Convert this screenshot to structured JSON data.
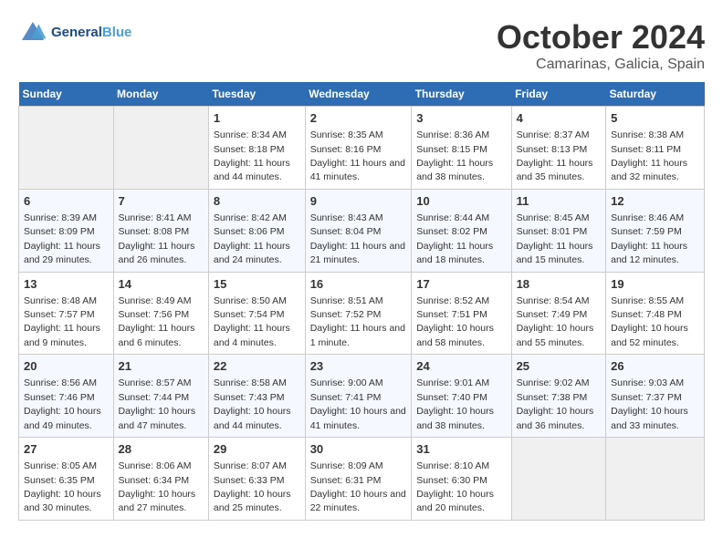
{
  "header": {
    "logo_text_general": "General",
    "logo_text_blue": "Blue",
    "month": "October 2024",
    "location": "Camarinas, Galicia, Spain"
  },
  "days_of_week": [
    "Sunday",
    "Monday",
    "Tuesday",
    "Wednesday",
    "Thursday",
    "Friday",
    "Saturday"
  ],
  "weeks": [
    [
      {
        "day": "",
        "empty": true
      },
      {
        "day": "",
        "empty": true
      },
      {
        "day": "1",
        "sunrise": "Sunrise: 8:34 AM",
        "sunset": "Sunset: 8:18 PM",
        "daylight": "Daylight: 11 hours and 44 minutes."
      },
      {
        "day": "2",
        "sunrise": "Sunrise: 8:35 AM",
        "sunset": "Sunset: 8:16 PM",
        "daylight": "Daylight: 11 hours and 41 minutes."
      },
      {
        "day": "3",
        "sunrise": "Sunrise: 8:36 AM",
        "sunset": "Sunset: 8:15 PM",
        "daylight": "Daylight: 11 hours and 38 minutes."
      },
      {
        "day": "4",
        "sunrise": "Sunrise: 8:37 AM",
        "sunset": "Sunset: 8:13 PM",
        "daylight": "Daylight: 11 hours and 35 minutes."
      },
      {
        "day": "5",
        "sunrise": "Sunrise: 8:38 AM",
        "sunset": "Sunset: 8:11 PM",
        "daylight": "Daylight: 11 hours and 32 minutes."
      }
    ],
    [
      {
        "day": "6",
        "sunrise": "Sunrise: 8:39 AM",
        "sunset": "Sunset: 8:09 PM",
        "daylight": "Daylight: 11 hours and 29 minutes."
      },
      {
        "day": "7",
        "sunrise": "Sunrise: 8:41 AM",
        "sunset": "Sunset: 8:08 PM",
        "daylight": "Daylight: 11 hours and 26 minutes."
      },
      {
        "day": "8",
        "sunrise": "Sunrise: 8:42 AM",
        "sunset": "Sunset: 8:06 PM",
        "daylight": "Daylight: 11 hours and 24 minutes."
      },
      {
        "day": "9",
        "sunrise": "Sunrise: 8:43 AM",
        "sunset": "Sunset: 8:04 PM",
        "daylight": "Daylight: 11 hours and 21 minutes."
      },
      {
        "day": "10",
        "sunrise": "Sunrise: 8:44 AM",
        "sunset": "Sunset: 8:02 PM",
        "daylight": "Daylight: 11 hours and 18 minutes."
      },
      {
        "day": "11",
        "sunrise": "Sunrise: 8:45 AM",
        "sunset": "Sunset: 8:01 PM",
        "daylight": "Daylight: 11 hours and 15 minutes."
      },
      {
        "day": "12",
        "sunrise": "Sunrise: 8:46 AM",
        "sunset": "Sunset: 7:59 PM",
        "daylight": "Daylight: 11 hours and 12 minutes."
      }
    ],
    [
      {
        "day": "13",
        "sunrise": "Sunrise: 8:48 AM",
        "sunset": "Sunset: 7:57 PM",
        "daylight": "Daylight: 11 hours and 9 minutes."
      },
      {
        "day": "14",
        "sunrise": "Sunrise: 8:49 AM",
        "sunset": "Sunset: 7:56 PM",
        "daylight": "Daylight: 11 hours and 6 minutes."
      },
      {
        "day": "15",
        "sunrise": "Sunrise: 8:50 AM",
        "sunset": "Sunset: 7:54 PM",
        "daylight": "Daylight: 11 hours and 4 minutes."
      },
      {
        "day": "16",
        "sunrise": "Sunrise: 8:51 AM",
        "sunset": "Sunset: 7:52 PM",
        "daylight": "Daylight: 11 hours and 1 minute."
      },
      {
        "day": "17",
        "sunrise": "Sunrise: 8:52 AM",
        "sunset": "Sunset: 7:51 PM",
        "daylight": "Daylight: 10 hours and 58 minutes."
      },
      {
        "day": "18",
        "sunrise": "Sunrise: 8:54 AM",
        "sunset": "Sunset: 7:49 PM",
        "daylight": "Daylight: 10 hours and 55 minutes."
      },
      {
        "day": "19",
        "sunrise": "Sunrise: 8:55 AM",
        "sunset": "Sunset: 7:48 PM",
        "daylight": "Daylight: 10 hours and 52 minutes."
      }
    ],
    [
      {
        "day": "20",
        "sunrise": "Sunrise: 8:56 AM",
        "sunset": "Sunset: 7:46 PM",
        "daylight": "Daylight: 10 hours and 49 minutes."
      },
      {
        "day": "21",
        "sunrise": "Sunrise: 8:57 AM",
        "sunset": "Sunset: 7:44 PM",
        "daylight": "Daylight: 10 hours and 47 minutes."
      },
      {
        "day": "22",
        "sunrise": "Sunrise: 8:58 AM",
        "sunset": "Sunset: 7:43 PM",
        "daylight": "Daylight: 10 hours and 44 minutes."
      },
      {
        "day": "23",
        "sunrise": "Sunrise: 9:00 AM",
        "sunset": "Sunset: 7:41 PM",
        "daylight": "Daylight: 10 hours and 41 minutes."
      },
      {
        "day": "24",
        "sunrise": "Sunrise: 9:01 AM",
        "sunset": "Sunset: 7:40 PM",
        "daylight": "Daylight: 10 hours and 38 minutes."
      },
      {
        "day": "25",
        "sunrise": "Sunrise: 9:02 AM",
        "sunset": "Sunset: 7:38 PM",
        "daylight": "Daylight: 10 hours and 36 minutes."
      },
      {
        "day": "26",
        "sunrise": "Sunrise: 9:03 AM",
        "sunset": "Sunset: 7:37 PM",
        "daylight": "Daylight: 10 hours and 33 minutes."
      }
    ],
    [
      {
        "day": "27",
        "sunrise": "Sunrise: 8:05 AM",
        "sunset": "Sunset: 6:35 PM",
        "daylight": "Daylight: 10 hours and 30 minutes."
      },
      {
        "day": "28",
        "sunrise": "Sunrise: 8:06 AM",
        "sunset": "Sunset: 6:34 PM",
        "daylight": "Daylight: 10 hours and 27 minutes."
      },
      {
        "day": "29",
        "sunrise": "Sunrise: 8:07 AM",
        "sunset": "Sunset: 6:33 PM",
        "daylight": "Daylight: 10 hours and 25 minutes."
      },
      {
        "day": "30",
        "sunrise": "Sunrise: 8:09 AM",
        "sunset": "Sunset: 6:31 PM",
        "daylight": "Daylight: 10 hours and 22 minutes."
      },
      {
        "day": "31",
        "sunrise": "Sunrise: 8:10 AM",
        "sunset": "Sunset: 6:30 PM",
        "daylight": "Daylight: 10 hours and 20 minutes."
      },
      {
        "day": "",
        "empty": true
      },
      {
        "day": "",
        "empty": true
      }
    ]
  ]
}
